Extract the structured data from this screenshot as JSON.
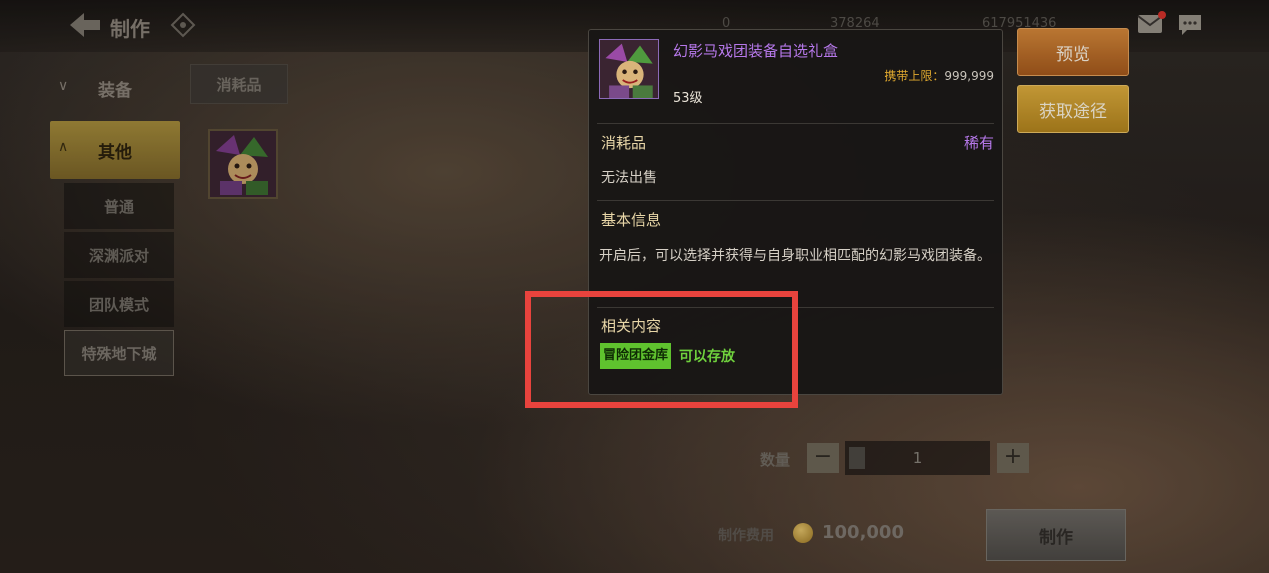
{
  "top_bar": {
    "title": "制作",
    "resource_1": "0",
    "resource_2": "378264",
    "resource_3": "617951436"
  },
  "left_nav": {
    "category_equipment": "装备",
    "category_other": "其他",
    "subcategories": [
      {
        "label": "普通"
      },
      {
        "label": "深渊派对"
      },
      {
        "label": "团队模式"
      },
      {
        "label": "特殊地下城"
      }
    ]
  },
  "tabs": {
    "consumable": "消耗品"
  },
  "tooltip": {
    "item_name": "幻影马戏团装备自选礼盒",
    "carry_limit_label": "携带上限：",
    "carry_limit_value": "999,999",
    "level": "53级",
    "type": "消耗品",
    "rarity": "稀有",
    "sell_status": "无法出售",
    "basic_info_header": "基本信息",
    "description": "开启后，可以选择并获得与自身职业相匹配的幻影马戏团装备。",
    "related_header": "相关内容",
    "related_tag": "冒险团金库",
    "related_text": "可以存放"
  },
  "actions": {
    "preview": "预览",
    "get_source": "获取途径"
  },
  "crafting": {
    "quantity_label": "数量",
    "quantity_value": "1",
    "cost_label": "制作费用",
    "cost_value": "100,000",
    "craft_button": "制作"
  },
  "colors": {
    "rarity_purple": "#b678ea",
    "highlight_red": "#e8433d",
    "stash_green": "#6fd13d",
    "preview_orange": "#d98a3a",
    "source_gold": "#e2b03e"
  }
}
